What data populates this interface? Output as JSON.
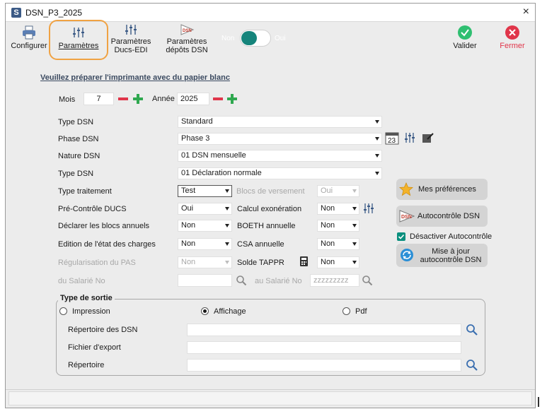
{
  "window": {
    "title": "DSN_P3_2025",
    "app_icon_letter": "S",
    "close_glyph": "×"
  },
  "toolbar": {
    "configurer": "Configurer",
    "parametres": "Paramètres",
    "param_ducs_line1": "Paramètres",
    "param_ducs_line2": "Ducs-EDI",
    "param_depots_line1": "Paramètres",
    "param_depots_line2": "dépôts DSN",
    "toggle_off": "Non",
    "toggle_on": "Oui",
    "valider": "Valider",
    "fermer": "Fermer",
    "colors": {
      "valider": "#2fbf71",
      "fermer": "#e0354a",
      "highlight": "#f0a243",
      "toggle": "#15847b"
    }
  },
  "form": {
    "notice": "Veuillez préparer l'imprimante avec du papier blanc",
    "mois_label": "Mois",
    "mois_value": "7",
    "annee_label": "Année",
    "annee_value": "2025",
    "type_dsn_label": "Type DSN",
    "type_dsn_value": "Standard",
    "phase_dsn_label": "Phase DSN",
    "phase_dsn_value": "Phase 3",
    "calendar_day": "23",
    "nature_dsn_label": "Nature DSN",
    "nature_dsn_value": "01 DSN mensuelle",
    "type_dsn2_label": "Type DSN",
    "type_dsn2_value": "01 Déclaration normale",
    "type_traitement_label": "Type traitement",
    "type_traitement_value": "Test",
    "blocs_versement_label": "Blocs de versement",
    "blocs_versement_value": "Oui",
    "pre_controle_label": "Pré-Contrôle DUCS",
    "pre_controle_value": "Oui",
    "calcul_exo_label": "Calcul exonération",
    "calcul_exo_value": "Non",
    "declarer_blocs_label": "Déclarer les blocs annuels",
    "declarer_blocs_value": "Non",
    "boeth_label": "BOETH annuelle",
    "boeth_value": "Non",
    "edition_label": "Edition de l'état des charges",
    "edition_value": "Non",
    "csa_label": "CSA annuelle",
    "csa_value": "Non",
    "regularisation_label": "Régularisation du PAS",
    "regularisation_value": "Non",
    "solde_label": "Solde TAPPR",
    "solde_value": "Non",
    "du_salarie_label": "du Salarié No",
    "du_salarie_value": "",
    "au_salarie_label": "au Salarié No",
    "au_salarie_placeholder": "zzzzzzzzz"
  },
  "side": {
    "mes_preferences": "Mes préférences",
    "autocontrole": "Autocontrôle DSN",
    "desactiver": "Désactiver Autocontrôle",
    "desactiver_checked": true,
    "mise_a_jour_line1": "Mise à jour",
    "mise_a_jour_line2": "autocontrôle DSN"
  },
  "sortie": {
    "title": "Type de sortie",
    "impression": "Impression",
    "affichage": "Affichage",
    "pdf": "Pdf",
    "selected": "Affichage",
    "repertoire_dsn_label": "Répertoire des DSN",
    "repertoire_dsn_value": "",
    "fichier_export_label": "Fichier d'export",
    "fichier_export_value": "",
    "repertoire_label": "Répertoire",
    "repertoire_value": ""
  }
}
